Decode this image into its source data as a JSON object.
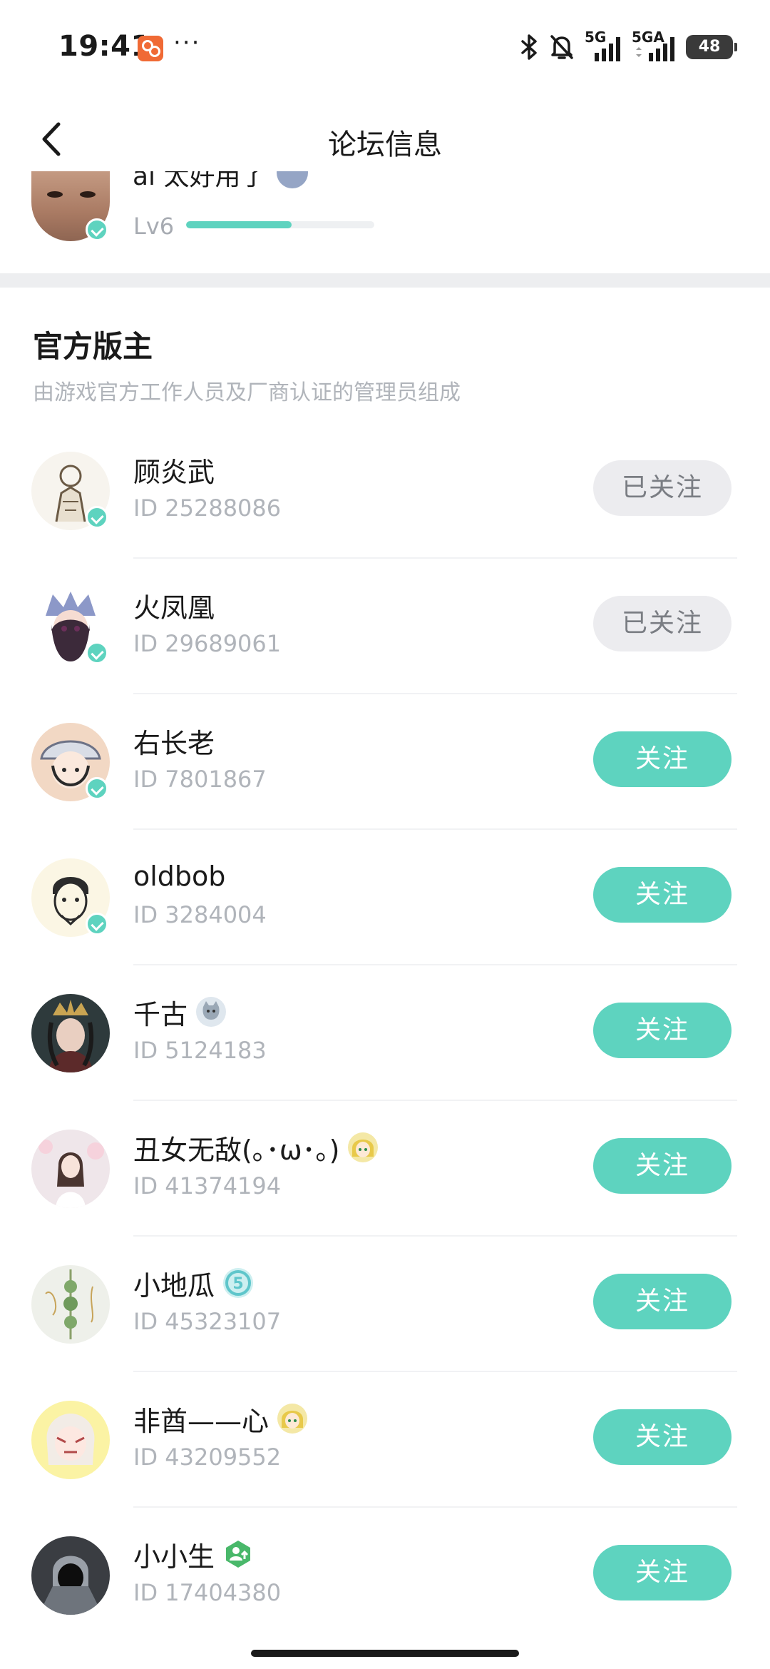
{
  "status_bar": {
    "time": "19:41",
    "app_icon": "kuaishou-app-icon",
    "more": "···",
    "signal1_label": "5G",
    "signal2_label": "5GA",
    "battery_level": "48",
    "icons": [
      "bluetooth-icon",
      "bell-muted-icon",
      "signal-icon",
      "signal-icon",
      "battery-icon"
    ]
  },
  "nav": {
    "title": "论坛信息",
    "back_icon": "chevron-left-icon"
  },
  "top_user": {
    "name": "ai 太好用了",
    "level": "Lv6",
    "level_progress": 0.56
  },
  "section": {
    "title": "官方版主",
    "subtitle": "由游戏官方工作人员及厂商认证的管理员组成"
  },
  "moderators": [
    {
      "name": "顾炎武",
      "id": "ID 25288086",
      "button": "已关注",
      "followed": true,
      "verified": true,
      "emblem": ""
    },
    {
      "name": "火凤凰",
      "id": "ID 29689061",
      "button": "已关注",
      "followed": true,
      "verified": true,
      "emblem": ""
    },
    {
      "name": "右长老",
      "id": "ID 7801867",
      "button": "关注",
      "followed": false,
      "verified": true,
      "emblem": ""
    },
    {
      "name": "oldbob",
      "id": "ID 3284004",
      "button": "关注",
      "followed": false,
      "verified": true,
      "emblem": ""
    },
    {
      "name": "千古",
      "id": "ID 5124183",
      "button": "关注",
      "followed": false,
      "verified": false,
      "emblem": "cat-badge-icon"
    },
    {
      "name": "丑女无敌(｡･ω･｡)",
      "id": "ID 41374194",
      "button": "关注",
      "followed": false,
      "verified": false,
      "emblem": "anime-girl-badge-icon"
    },
    {
      "name": "小地瓜",
      "id": "ID 45323107",
      "button": "关注",
      "followed": false,
      "verified": false,
      "emblem": "number-five-badge-icon"
    },
    {
      "name": "非酋——心",
      "id": "ID 43209552",
      "button": "关注",
      "followed": false,
      "verified": false,
      "emblem": "anime-girl-badge-icon"
    },
    {
      "name": "小小生",
      "id": "ID 17404380",
      "button": "关注",
      "followed": false,
      "verified": false,
      "emblem": "user-upgrade-badge-icon"
    }
  ],
  "colors": {
    "accent": "#5ed3bf",
    "followed_bg": "#ececef",
    "followed_text": "#7a7d83",
    "subtext": "#b0b4ba",
    "divider": "#edeef0"
  }
}
